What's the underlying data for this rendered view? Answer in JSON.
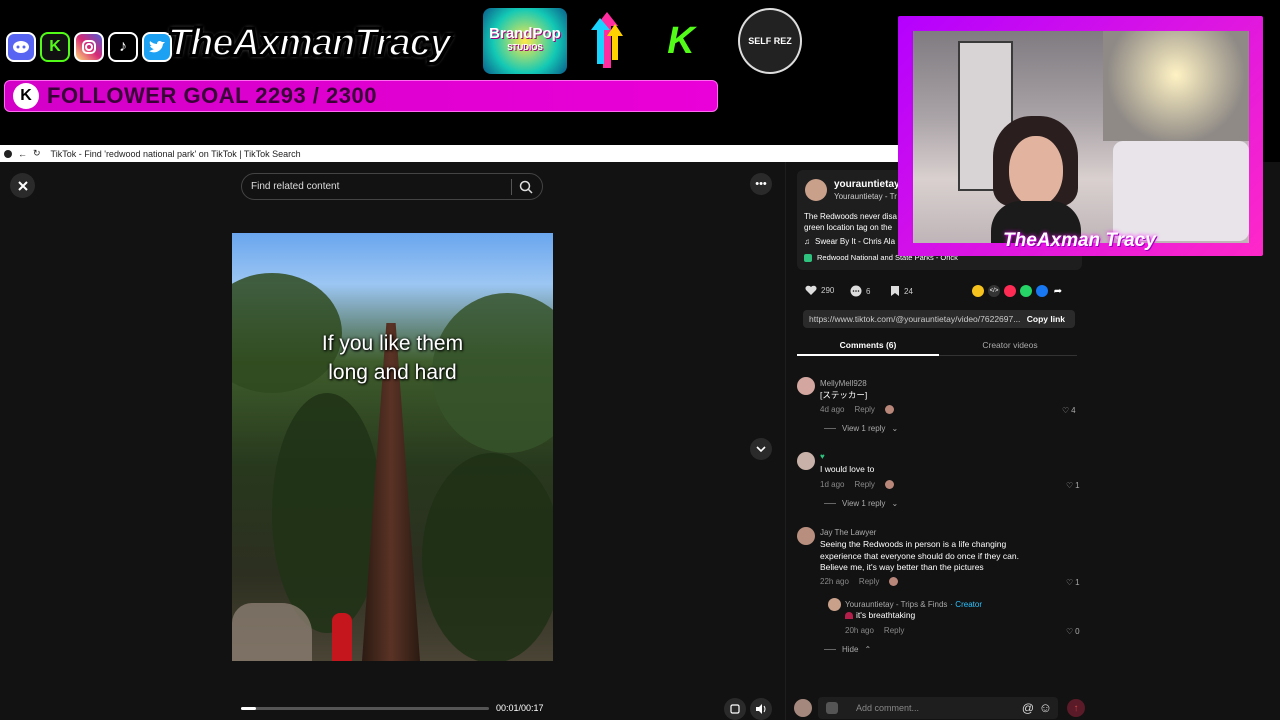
{
  "stream_overlay": {
    "handle": "TheAxmanTracy",
    "goal_text": "FOLLOWER GOAL 2293 / 2300",
    "goal_icon": "K",
    "goal_progress": 0.997,
    "logos": [
      "BrandPop",
      "STUDIOS",
      "SELF REZ"
    ],
    "webcam_name": "TheAxman Tracy",
    "social_icons": [
      "discord-icon",
      "kick-icon",
      "instagram-icon",
      "tiktok-icon",
      "twitter-icon"
    ]
  },
  "browser": {
    "tab_title": "TikTok - Find 'redwood national park' on TikTok | TikTok Search"
  },
  "search": {
    "placeholder": "Find related content"
  },
  "video": {
    "caption_line1": "If you like them",
    "caption_line2": "long and hard",
    "time": "00:01/00:17",
    "progress": 0.06
  },
  "post": {
    "username": "yourauntietay",
    "display_name": "Yourauntietay - Tr",
    "description_line1": "The Redwoods never disa",
    "description_line2": "green location tag on the",
    "music": "Swear By It - Chris Ala",
    "location": "Redwood National and State Parks - Orick",
    "likes": "290",
    "comments": "6",
    "saves": "24",
    "link": "https://www.tiktok.com/@yourauntietay/video/7622697...",
    "copy_link": "Copy link"
  },
  "tabs": {
    "comments": "Comments (6)",
    "creator_videos": "Creator videos"
  },
  "comments": [
    {
      "name": "MellyMell928",
      "text": "[ステッカー]",
      "time": "4d ago",
      "reply": "Reply",
      "likes": "4",
      "view_replies": "View 1 reply"
    },
    {
      "name": "",
      "badge": "♥",
      "text": "I would love to",
      "time": "1d ago",
      "reply": "Reply",
      "likes": "1",
      "view_replies": "View 1 reply"
    },
    {
      "name": "Jay The Lawyer",
      "text1": "Seeing the Redwoods in person is a life changing",
      "text2": "experience that everyone should do once if they can.",
      "text3": "Believe me, it's way better than the pictures",
      "time": "22h ago",
      "reply": "Reply",
      "likes": "1"
    }
  ],
  "reply": {
    "name": "Yourauntietay - Trips & Finds",
    "creator_tag": "· Creator",
    "text": "it's breathtaking",
    "time": "20h ago",
    "reply": "Reply",
    "likes": "0",
    "hide": "Hide"
  },
  "composer": {
    "placeholder": "Add comment..."
  },
  "colors": {
    "goal_bar": "#e200d2",
    "tiktok_red": "#fe2c55",
    "creator_tag": "#2dc3ff"
  }
}
